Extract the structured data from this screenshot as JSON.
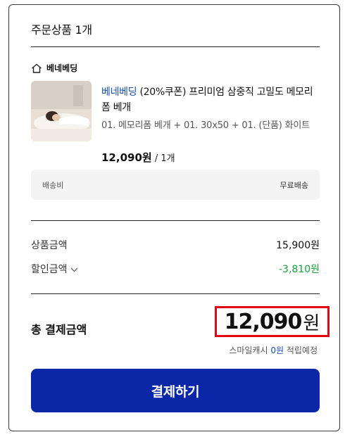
{
  "order": {
    "title": "주문상품 1개",
    "seller_name": "베네베딩",
    "product": {
      "brand": "베네베딩",
      "name_rest": " (20%쿠폰) 프리미엄 삼중직 고밀도 메모리폼 베개",
      "option": "01. 메모리폼 베개 + 01. 30x50 + 01. (단품) 화이트",
      "price": "12,090원",
      "quantity": " / 1개"
    },
    "shipping": {
      "label": "배송비",
      "value": "무료배송"
    }
  },
  "summary": {
    "product_amount_label": "상품금액",
    "product_amount_value": "15,900원",
    "discount_label": "할인금액",
    "discount_value": "-3,810원"
  },
  "total": {
    "label": "총 결제금액",
    "amount": "12,090",
    "unit": "원",
    "cash_prefix": "스마일캐시 ",
    "cash_amount": "0원",
    "cash_suffix": " 적립예정"
  },
  "pay_button_label": "결제하기",
  "colors": {
    "brand_blue": "#1a4fb3",
    "button_blue": "#0a27a8",
    "discount_green": "#1aa33a",
    "highlight_red": "#e60012"
  },
  "icons": {
    "seller": "home-icon",
    "discount_toggle": "chevron-down-icon"
  }
}
